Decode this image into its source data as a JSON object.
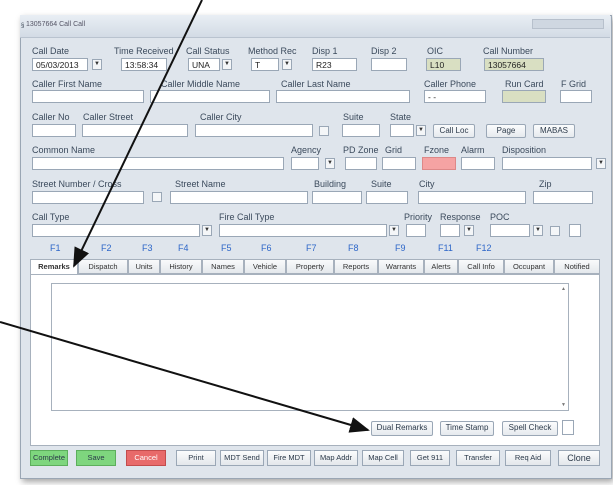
{
  "window": {
    "title": "13057664 Call Call"
  },
  "row1": {
    "call_date_label": "Call Date",
    "call_date": "05/03/2013",
    "time_received_label": "Time Received",
    "time_received": "13:58:34",
    "call_status_label": "Call Status",
    "call_status": "UNA",
    "method_rec_label": "Method Rec",
    "method_rec": "T",
    "disp1_label": "Disp 1",
    "disp1": "R23",
    "disp2_label": "Disp 2",
    "disp2": "",
    "oic_label": "OIC",
    "oic": "L10",
    "call_number_label": "Call Number",
    "call_number": "13057664"
  },
  "row2": {
    "caller_first_name_label": "Caller First Name",
    "caller_middle_name_label": "Caller Middle Name",
    "caller_last_name_label": "Caller Last Name",
    "caller_phone_label": "Caller Phone",
    "caller_phone": "-   -",
    "run_card_label": "Run Card",
    "f_grid_label": "F Grid"
  },
  "row3": {
    "caller_no_label": "Caller No",
    "caller_street_label": "Caller Street",
    "caller_city_label": "Caller City",
    "suite_label": "Suite",
    "state_label": "State",
    "call_loc_button": "Call Loc",
    "page_button": "Page",
    "mabas_button": "MABAS"
  },
  "row4": {
    "common_name_label": "Common Name",
    "agency_label": "Agency",
    "pd_zone_label": "PD Zone",
    "grid_label": "Grid",
    "fzone_label": "Fzone",
    "alarm_label": "Alarm",
    "disposition_label": "Disposition"
  },
  "row5": {
    "street_number_label": "Street Number / Cross",
    "street_name_label": "Street Name",
    "building_label": "Building",
    "suite_label": "Suite",
    "city_label": "City",
    "zip_label": "Zip"
  },
  "row6": {
    "call_type_label": "Call Type",
    "fire_call_type_label": "Fire Call Type",
    "priority_label": "Priority",
    "response_label": "Response",
    "poc_label": "POC"
  },
  "fkeys": [
    "F1",
    "F2",
    "F3",
    "F4",
    "F5",
    "F6",
    "F7",
    "F8",
    "F9",
    "F11",
    "F12"
  ],
  "tabs": [
    "Remarks",
    "Dispatch",
    "Units",
    "History",
    "Names",
    "Vehicle",
    "Property",
    "Reports",
    "Warrants",
    "Alerts",
    "Call Info",
    "Occupant",
    "Notified"
  ],
  "remarks_buttons": {
    "dual_remarks": "Dual Remarks",
    "time_stamp": "Time Stamp",
    "spell_check": "Spell Check"
  },
  "bottom_buttons": [
    "Complete",
    "Save",
    "Cancel",
    "Print",
    "MDT Send",
    "Fire MDT",
    "Map Addr",
    "Map Cell",
    "Get 911",
    "Transfer",
    "Req Aid",
    "Clone"
  ],
  "colors": {
    "complete": "#7ed67e",
    "save": "#7ed67e",
    "cancel": "#e86a6a",
    "fzone": "#f5a3a3",
    "oic": "#d9dfc2",
    "fkey": "#2d66c8"
  }
}
